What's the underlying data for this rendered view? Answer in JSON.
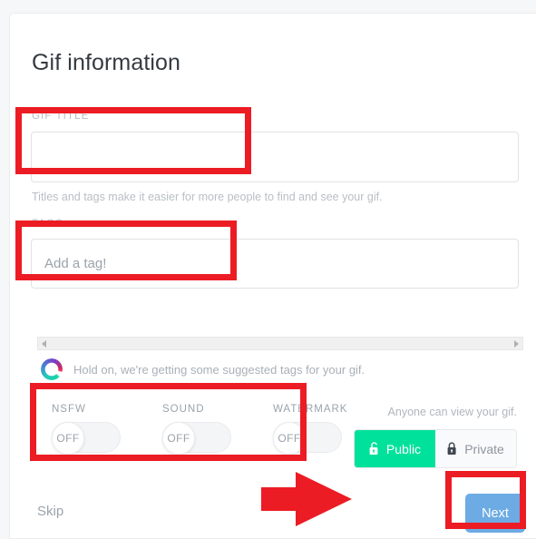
{
  "page": {
    "title": "Gif information",
    "background_color": "#f6f7f8",
    "card_color": "#ffffff"
  },
  "form": {
    "title_field": {
      "label": "GIF TITLE",
      "value": "",
      "placeholder": ""
    },
    "helper_text": "Titles and tags make it easier for more people to find and see your gif.",
    "tags_field": {
      "label": "TAGS",
      "value": "",
      "placeholder": "Add a tag!"
    }
  },
  "suggestions": {
    "status_text": "Hold on, we're getting some suggested tags for your gif.",
    "spinner_icon": "loading-spinner-icon",
    "scrollbar": {
      "left_arrow_icon": "chevron-left-icon",
      "right_arrow_icon": "chevron-right-icon"
    }
  },
  "toggles": [
    {
      "caption": "NSFW",
      "state": "OFF"
    },
    {
      "caption": "SOUND",
      "state": "OFF"
    },
    {
      "caption": "WATERMARK",
      "state": "OFF"
    }
  ],
  "privacy": {
    "note": "Anyone can view your gif.",
    "public": {
      "label": "Public",
      "icon": "unlock-icon",
      "selected": true,
      "color": "#00e19b"
    },
    "private": {
      "label": "Private",
      "icon": "lock-icon",
      "selected": false,
      "color": "#f9fafb"
    }
  },
  "footer": {
    "skip_label": "Skip",
    "next_label": "Next",
    "next_color": "#6cabe3"
  },
  "annotations": {
    "highlight_color": "#ec1c24",
    "arrow_icon": "arrow-right-annotation"
  }
}
